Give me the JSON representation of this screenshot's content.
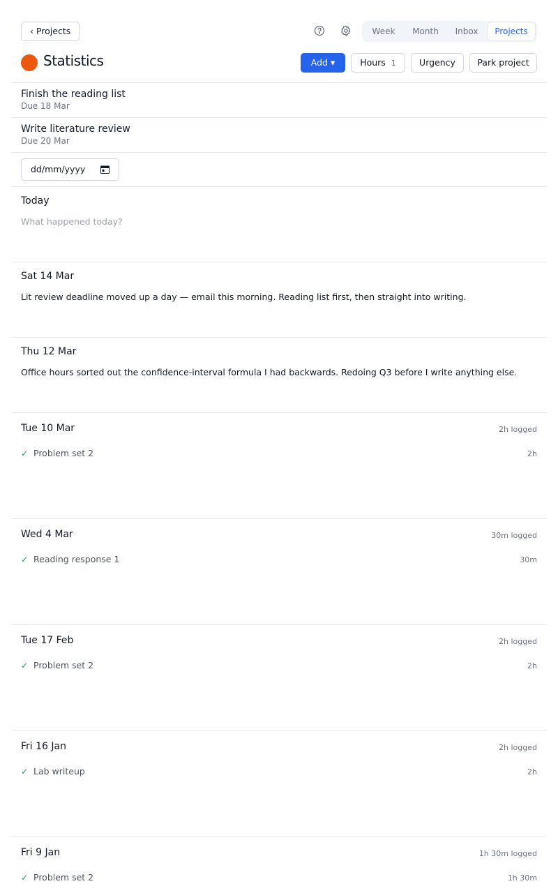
{
  "nav": {
    "back_label": "‹ Projects",
    "help_icon": "help-circle-icon",
    "settings_icon": "gear-icon",
    "tabs": [
      "Week",
      "Month",
      "Inbox",
      "Projects"
    ],
    "active_tab": "Projects"
  },
  "project": {
    "title": "Statistics",
    "color": "#ea580c"
  },
  "actions": {
    "add_label": "Add ▾",
    "hours_label": "Hours",
    "hours_count": "1",
    "urgency_label": "Urgency",
    "park_label": "Park project"
  },
  "tasks": [
    {
      "title": "Finish the reading list",
      "due": "Due 18 Mar"
    },
    {
      "title": "Write literature review",
      "due": "Due 20 Mar"
    }
  ],
  "date_picker": {
    "placeholder": "dd/mm/yyyy"
  },
  "today": {
    "heading": "Today",
    "placeholder": "What happened today?"
  },
  "days": [
    {
      "heading": "Sat 14 Mar",
      "note": "Lit review deadline moved up a day — email this morning. Reading list first, then straight into writing."
    },
    {
      "heading": "Thu 12 Mar",
      "note": "Office hours sorted out the confidence-interval formula I had backwards. Redoing Q3 before I write anything else."
    },
    {
      "heading": "Tue 10 Mar",
      "logged": "2h logged",
      "entries": [
        {
          "name": "Problem set 2",
          "time": "2h"
        }
      ]
    },
    {
      "heading": "Wed 4 Mar",
      "logged": "30m logged",
      "entries": [
        {
          "name": "Reading response 1",
          "time": "30m"
        }
      ]
    },
    {
      "heading": "Tue 17 Feb",
      "logged": "2h logged",
      "entries": [
        {
          "name": "Problem set 2",
          "time": "2h"
        }
      ]
    },
    {
      "heading": "Fri 16 Jan",
      "logged": "2h logged",
      "entries": [
        {
          "name": "Lab writeup",
          "time": "2h"
        }
      ]
    },
    {
      "heading": "Fri 9 Jan",
      "logged": "1h 30m logged",
      "entries": [
        {
          "name": "Problem set 2",
          "time": "1h 30m"
        }
      ]
    }
  ],
  "check_glyph": "✓",
  "colors": {
    "accent": "#2563eb",
    "done": "#16a34a"
  }
}
